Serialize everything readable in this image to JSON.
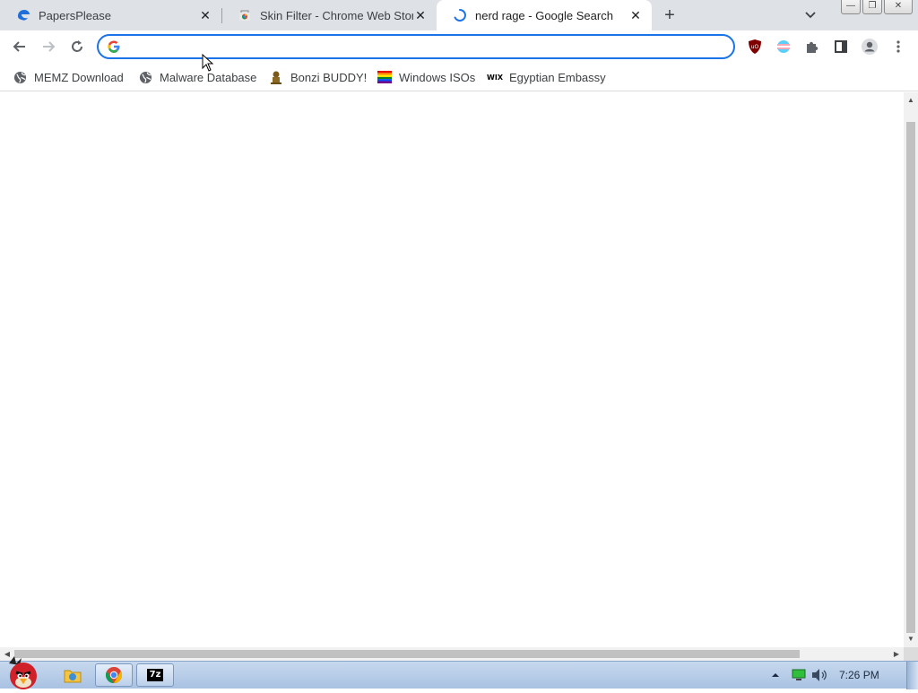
{
  "tabs": [
    {
      "title": "PapersPlease",
      "favicon": "edge-like-icon",
      "active": false
    },
    {
      "title": "Skin Filter - Chrome Web Store",
      "favicon": "chrome-web-store-icon",
      "active": false
    },
    {
      "title": "nerd rage - Google Search",
      "favicon": "loading-spinner-icon",
      "active": true
    }
  ],
  "tab_close_glyph": "✕",
  "new_tab_glyph": "+",
  "window_controls": {
    "minimize": "—",
    "restore": "❐",
    "close": "✕"
  },
  "omnibox": {
    "value": "",
    "placeholder": ""
  },
  "bookmarks": [
    {
      "label": "MEMZ Download",
      "icon": "globe-icon"
    },
    {
      "label": "Malware Database",
      "icon": "globe-icon"
    },
    {
      "label": "Bonzi BUDDY!",
      "icon": "bonzi-icon"
    },
    {
      "label": "Windows ISOs",
      "icon": "rainbow-flag-icon"
    },
    {
      "label": "Egyptian Embassy",
      "icon": "wix-icon"
    }
  ],
  "wix_text": "WIX",
  "taskbar": {
    "clock": "7:26 PM",
    "items": [
      "explorer-icon",
      "chrome-icon",
      "7zip-icon"
    ],
    "sevenzip_label": "7z"
  },
  "colors": {
    "accent": "#1a73e8",
    "tabstrip": "#dee1e6",
    "taskbar": "#b8cde8"
  }
}
